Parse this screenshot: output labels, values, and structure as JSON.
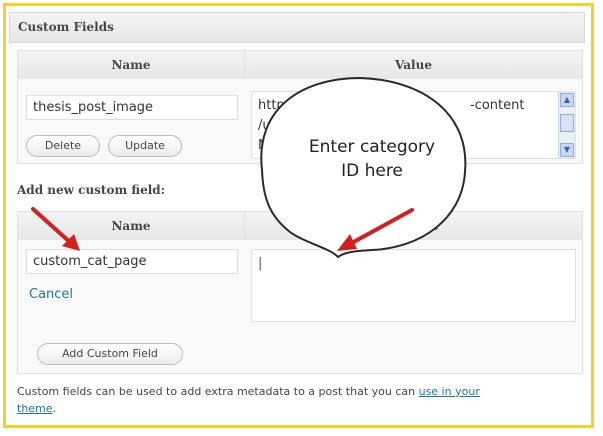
{
  "panel": {
    "title": "Custom Fields"
  },
  "existing": {
    "col_name": "Name",
    "col_value": "Value",
    "field_name": "thesis_post_image",
    "field_value_lines": [
      "http",
      "/u",
      "M"
    ],
    "field_value_tail": "-content",
    "delete_label": "Delete",
    "update_label": "Update"
  },
  "add_new": {
    "heading": "Add new custom field:",
    "col_name": "Name",
    "col_value_tail": "e",
    "name_value": "custom_cat_page",
    "cancel_label": "Cancel",
    "value_value": "|",
    "add_button_label": "Add Custom Field"
  },
  "callout": {
    "line1": "Enter category",
    "line2": "ID here"
  },
  "footer": {
    "text_before": "Custom fields can be used to add extra metadata to a post that you can ",
    "link_text_1": "use in your",
    "link_text_2": "theme",
    "text_after": "."
  },
  "colors": {
    "frame_border": "#f2d12a",
    "arrow_red": "#d21f1f",
    "link_blue": "#21759b"
  }
}
